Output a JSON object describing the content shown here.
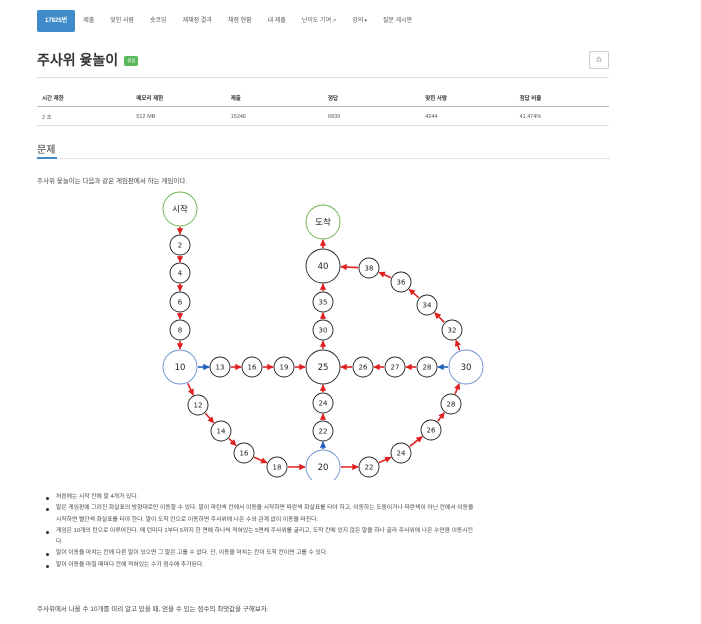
{
  "nav": {
    "items": [
      "17825번",
      "제출",
      "맞힌 사람",
      "숏코딩",
      "재채점 결과",
      "채점 현황",
      "내 제출",
      "난이도 기여",
      "강의",
      "질문 게시판"
    ]
  },
  "problem": {
    "title": "주사위 윷놀이",
    "badge": "성공",
    "star": "☆"
  },
  "stats": {
    "headers": [
      "시간 제한",
      "메모리 제한",
      "제출",
      "정답",
      "맞힌 사람",
      "정답 비율"
    ],
    "values": [
      "2 초",
      "512 MB",
      "15246",
      "6839",
      "4244",
      "41.474%"
    ]
  },
  "section_title": "문제",
  "intro": "주사위 윷놀이는 다음과 같은 게임판에서 하는 게임이다.",
  "board": {
    "start": "시작",
    "finish": "도착",
    "colors": {
      "red": "#e02020",
      "blue": "#1f5fbf",
      "green_ring": "#6ab04c",
      "blue_ring": "#6a8fd0"
    }
  },
  "rules": [
    "처음에는 시작 칸에 말 4개가 있다.",
    "말은 게임판에 그려진 화살표의 방향대로만 이동할 수 있다. 말이 파란색 칸에서 이동을 시작하면 파란색 화살표를 타야 하고, 이동하는 도중이거나 파란색이 아닌 칸에서 이동을",
    "시작하면 빨간색 화살표를 타야 한다. 말이 도착 칸으로 이동하면 주사위에 나온 수와 관계 없이 이동을 마친다.",
    "게임은 10개의 턴으로 이루어진다. 매 턴마다 1부터 5까지 한 면에 하나씩 적혀있는 5면체 주사위를 굴리고, 도착 칸에 있지 않은 말을 하나 골라 주사위에 나온 수만큼 이동시킨",
    "다.",
    "말이 이동을 마치는 칸에 다른 말이 있으면 그 말은 고를 수 없다. 단, 이동을 마치는 칸이 도착 칸이면 고를 수 있다.",
    "말이 이동을 마칠 때마다 칸에 적혀있는 수가 점수에 추가된다."
  ],
  "outro": "주사위에서 나올 수 10개를 미리 알고 있을 때, 얻을 수 있는 점수의 최댓값을 구해보자."
}
